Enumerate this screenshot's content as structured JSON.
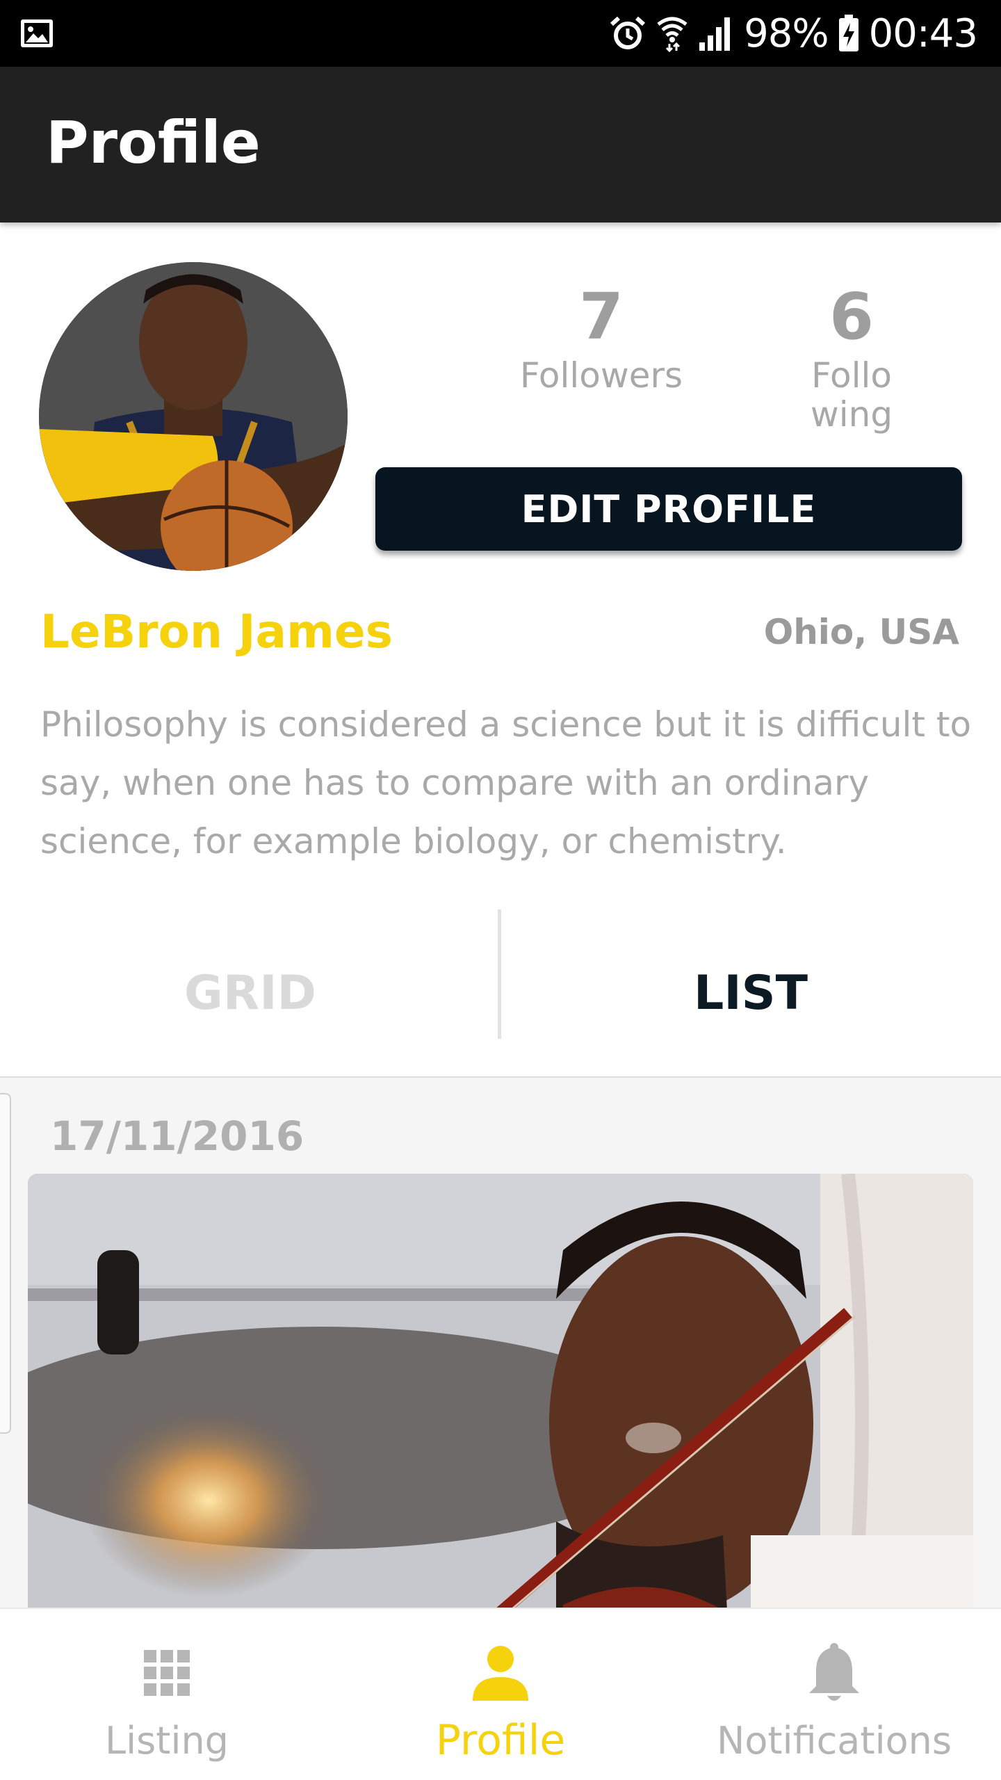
{
  "status_bar": {
    "battery": "98%",
    "time": "00:43"
  },
  "app_bar": {
    "title": "Profile"
  },
  "profile": {
    "name": "LeBron James",
    "location": "Ohio, USA",
    "bio": "Philosophy is considered a science but it is difficult to say, when one has to compare with an ordinary science, for example biology, or chemistry.",
    "stats": {
      "followers_value": "7",
      "followers_label": "Followers",
      "following_value": "6",
      "following_label_line1": "Follo",
      "following_label_line2": "wing"
    },
    "edit_button_label": "EDIT PROFILE"
  },
  "view_tabs": {
    "grid_label": "GRID",
    "list_label": "LIST",
    "active": "list"
  },
  "feed": {
    "posts": [
      {
        "date": "17/11/2016"
      }
    ]
  },
  "bottom_nav": {
    "items": [
      {
        "label": "Listing",
        "icon": "grid-icon"
      },
      {
        "label": "Profile",
        "icon": "person-icon",
        "active": true
      },
      {
        "label": "Notifications",
        "icon": "bell-icon"
      }
    ]
  },
  "colors": {
    "accent": "#f5d20c",
    "app_bar": "#212121",
    "button": "#071520",
    "muted_text": "#a9a9a9"
  }
}
